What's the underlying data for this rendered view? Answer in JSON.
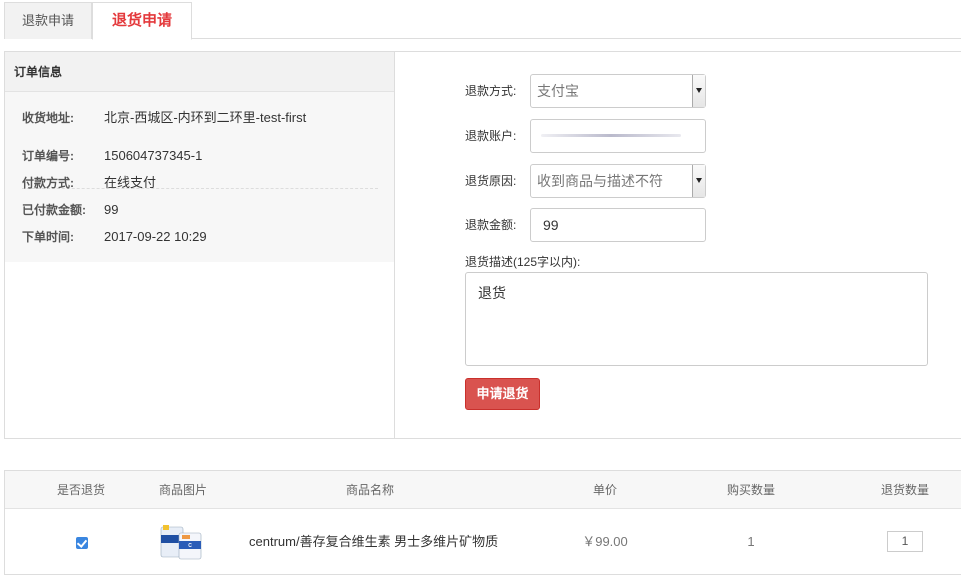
{
  "tabs": [
    {
      "label": "退款申请",
      "active": false
    },
    {
      "label": "退货申请",
      "active": true
    }
  ],
  "order": {
    "title": "订单信息",
    "address_label": "收货地址:",
    "address_value": "北京-西城区-内环到二环里-test-first",
    "order_no_label": "订单编号:",
    "order_no_value": "150604737345-1",
    "pay_method_label": "付款方式:",
    "pay_method_value": "在线支付",
    "paid_label": "已付款金额:",
    "paid_value": "99",
    "time_label": "下单时间:",
    "time_value": "2017-09-22 10:29"
  },
  "form": {
    "refund_method_label": "退款方式:",
    "refund_method_value": "支付宝",
    "refund_account_label": "退款账户:",
    "refund_account_value": "",
    "reason_label": "退货原因:",
    "reason_value": "收到商品与描述不符",
    "amount_label": "退款金额:",
    "amount_value": "99",
    "desc_label": "退货描述(125字以内):",
    "desc_value": "退货",
    "submit_label": "申请退货"
  },
  "table": {
    "headers": [
      "是否退货",
      "商品图片",
      "商品名称",
      "单价",
      "购买数量",
      "退货数量"
    ],
    "rows": [
      {
        "checked": true,
        "name": "centrum/善存复合维生素 男士多维片矿物质",
        "price": "￥99.00",
        "qty": "1",
        "return_qty": "1"
      }
    ]
  },
  "colors": {
    "accent": "#e4393c",
    "button": "#d9534f",
    "checkbox": "#3a86e0"
  }
}
